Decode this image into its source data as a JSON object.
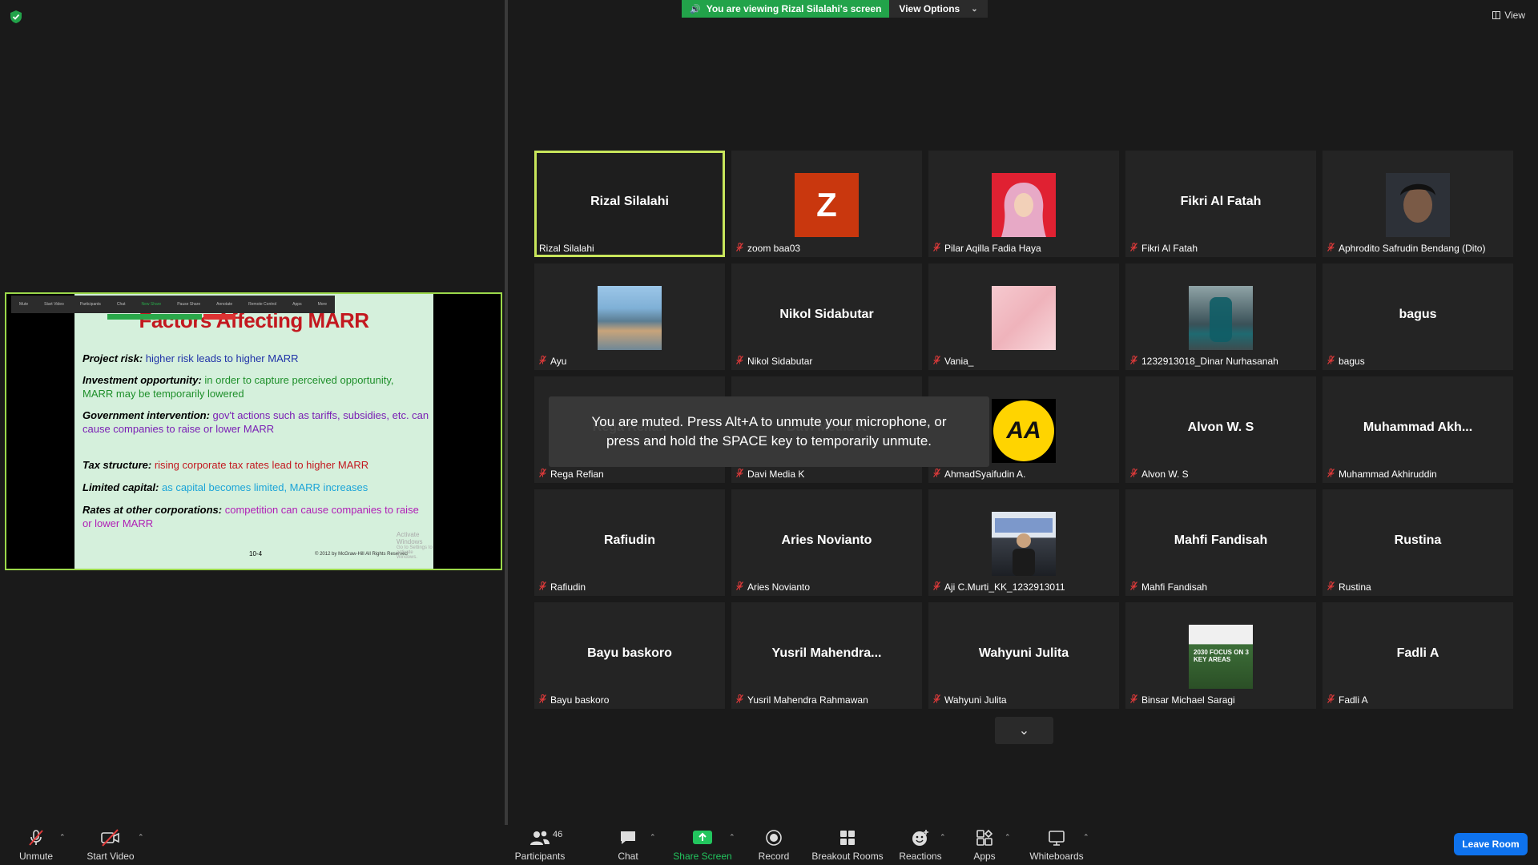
{
  "banner": {
    "sharing_text": "You are viewing Rizal Silalahi's screen",
    "view_options": "View Options"
  },
  "top_right": {
    "view_label": "View"
  },
  "shared_screen": {
    "mini_toolbar": [
      "Mute",
      "Start Video",
      "Participants",
      "Chat",
      "New Share",
      "Pause Share",
      "Annotate",
      "Remote Control",
      "Apps",
      "More"
    ],
    "slide": {
      "title": "Factors Affecting MARR",
      "lines": [
        {
          "label": "Project risk:",
          "text": "higher risk leads to higher MARR"
        },
        {
          "label": "Investment opportunity:",
          "text": "in order to capture perceived opportunity, MARR may be temporarily lowered"
        },
        {
          "label": "Government intervention:",
          "text": "gov't actions such as tariffs, subsidies, etc. can cause companies to raise or lower MARR"
        },
        {
          "label": "Tax structure:",
          "text": "rising corporate tax rates lead to higher MARR"
        },
        {
          "label": "Limited capital:",
          "text": "as capital becomes limited, MARR increases"
        },
        {
          "label": "Rates at other corporations:",
          "text": "competition can cause companies to raise or lower MARR"
        }
      ],
      "page_number": "10-4",
      "copyright": "© 2012 by McGraw-Hill   All Rights Reserved",
      "watermark_title": "Activate Windows",
      "watermark_sub": "Go to Settings to activate Windows."
    }
  },
  "participants": [
    {
      "display": "Rizal Silalahi",
      "name": "Rizal Silalahi",
      "avatar": "none",
      "active": true,
      "muted": false
    },
    {
      "display": "",
      "name": "zoom baa03",
      "avatar": "letter-z",
      "muted": true
    },
    {
      "display": "",
      "name": "Pilar Aqilla Fadia Haya",
      "avatar": "photo-hijab-red-bg",
      "muted": true
    },
    {
      "display": "Fikri Al Fatah",
      "name": "Fikri Al Fatah",
      "avatar": "none",
      "muted": true
    },
    {
      "display": "",
      "name": "Aphrodito Safrudin Bendang (Dito)",
      "avatar": "photo-selfie",
      "muted": true
    },
    {
      "display": "",
      "name": "Ayu",
      "avatar": "photo-city-aerial",
      "muted": true
    },
    {
      "display": "Nikol Sidabutar",
      "name": "Nikol Sidabutar",
      "avatar": "none",
      "muted": true
    },
    {
      "display": "",
      "name": "Vania_",
      "avatar": "photo-pink-texture",
      "muted": true
    },
    {
      "display": "",
      "name": "1232913018_Dinar Nurhasanah",
      "avatar": "photo-object",
      "muted": true
    },
    {
      "display": "bagus",
      "name": "bagus",
      "avatar": "none",
      "muted": true
    },
    {
      "display": "Rega Refian",
      "name": "Rega Refian",
      "avatar": "none",
      "muted": true
    },
    {
      "display": "Davi Media K",
      "name": "Davi Media K",
      "avatar": "none",
      "muted": true
    },
    {
      "display": "",
      "name": "AhmadSyaifudin A.",
      "avatar": "logo-aa",
      "avatar_text": "AA",
      "muted": true
    },
    {
      "display": "Alvon W. S",
      "name": "Alvon W. S",
      "avatar": "none",
      "muted": true
    },
    {
      "display": "Muhammad  Akh...",
      "name": "Muhammad Akhiruddin",
      "avatar": "none",
      "muted": true
    },
    {
      "display": "Rafiudin",
      "name": "Rafiudin",
      "avatar": "none",
      "muted": true
    },
    {
      "display": "Aries Novianto",
      "name": "Aries Novianto",
      "avatar": "none",
      "muted": true
    },
    {
      "display": "",
      "name": "Aji C.Murti_KK_1232913011",
      "avatar": "photo-person",
      "muted": true
    },
    {
      "display": "Mahfi Fandisah",
      "name": "Mahfi Fandisah",
      "avatar": "none",
      "muted": true
    },
    {
      "display": "Rustina",
      "name": "Rustina",
      "avatar": "none",
      "muted": true
    },
    {
      "display": "Bayu baskoro",
      "name": "Bayu baskoro",
      "avatar": "none",
      "muted": true
    },
    {
      "display": "Yusril  Mahendra...",
      "name": "Yusril Mahendra Rahmawan",
      "avatar": "none",
      "muted": true
    },
    {
      "display": "Wahyuni Julita",
      "name": "Wahyuni Julita",
      "avatar": "none",
      "muted": true
    },
    {
      "display": "",
      "name": "Binsar Michael Saragi",
      "avatar": "photo-2030-banner",
      "avatar_text": "2030 FOCUS ON 3 KEY AREAS",
      "muted": true
    },
    {
      "display": "Fadli A",
      "name": "Fadli A",
      "avatar": "none",
      "muted": true
    }
  ],
  "mute_toast": {
    "line1": "You are muted. Press Alt+A to unmute your microphone, or",
    "line2": "press and hold the SPACE key to temporarily unmute."
  },
  "toolbar": {
    "unmute": "Unmute",
    "start_video": "Start Video",
    "participants": "Participants",
    "participants_count": "46",
    "chat": "Chat",
    "share_screen": "Share Screen",
    "record": "Record",
    "breakout_rooms": "Breakout Rooms",
    "reactions": "Reactions",
    "apps": "Apps",
    "whiteboards": "Whiteboards",
    "leave_room": "Leave Room"
  },
  "colors": {
    "share_green": "#22a34a",
    "active_speaker_border": "#c8e65b",
    "leave_blue": "#0e72ed",
    "muted_red": "#e03a3a"
  }
}
